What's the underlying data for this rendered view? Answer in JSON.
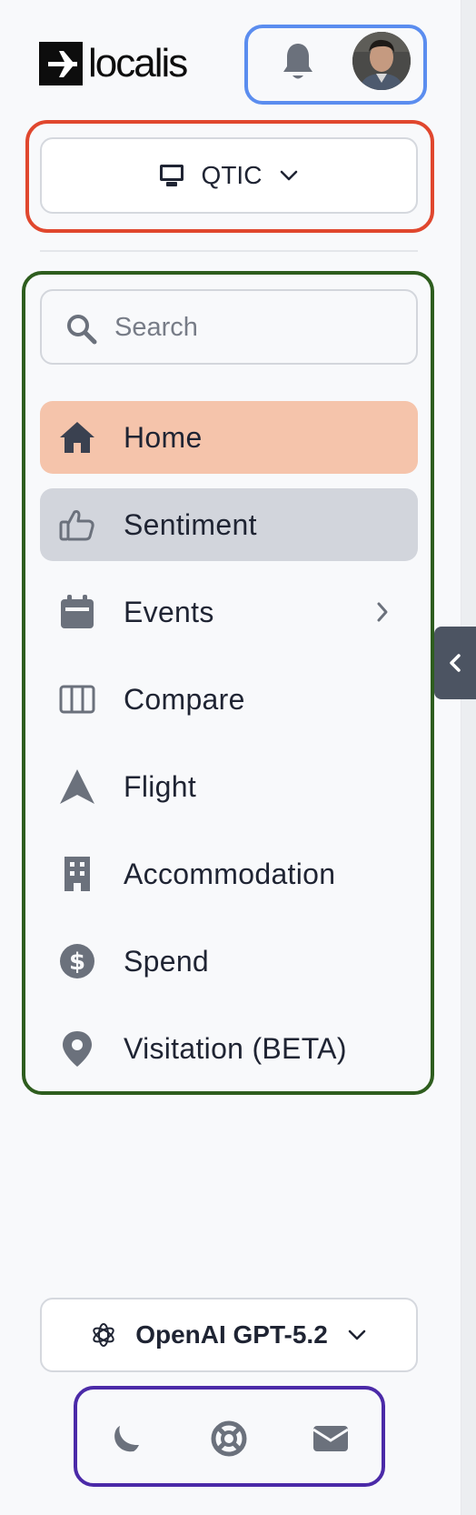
{
  "brand": {
    "name": "localis"
  },
  "header": {
    "bell_icon": "bell-icon",
    "avatar": "user-avatar"
  },
  "workspace": {
    "label": "QTIC",
    "icon": "monitor-icon"
  },
  "search": {
    "placeholder": "Search",
    "value": ""
  },
  "nav": {
    "items": [
      {
        "label": "Home",
        "icon": "home-icon",
        "state": "active"
      },
      {
        "label": "Sentiment",
        "icon": "thumbs-up-icon",
        "state": "hover"
      },
      {
        "label": "Events",
        "icon": "calendar-icon",
        "has_submenu": true
      },
      {
        "label": "Compare",
        "icon": "columns-icon"
      },
      {
        "label": "Flight",
        "icon": "navigation-arrow-icon"
      },
      {
        "label": "Accommodation",
        "icon": "building-icon"
      },
      {
        "label": "Spend",
        "icon": "dollar-circle-icon"
      },
      {
        "label": "Visitation (BETA)",
        "icon": "map-pin-icon"
      }
    ]
  },
  "model_selector": {
    "label": "OpenAI GPT-5.2",
    "icon": "openai-icon"
  },
  "footer": {
    "icons": [
      "moon-icon",
      "lifebuoy-icon",
      "mail-icon"
    ]
  },
  "colors": {
    "active_bg": "#f5c4ab",
    "hover_bg": "#d2d5dc",
    "icon_gray": "#6b717c",
    "header_outline": "#5b8def",
    "workspace_outline": "#e0472e",
    "nav_outline": "#2e5d1e",
    "footer_outline": "#4b2aa8"
  }
}
